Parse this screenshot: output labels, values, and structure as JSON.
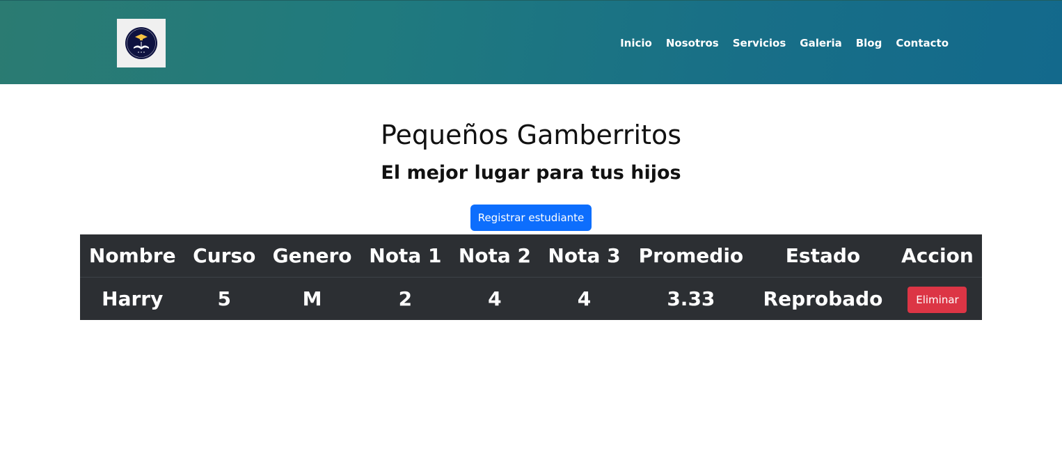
{
  "header": {
    "logo": "graduation-cap-book-logo",
    "nav": [
      "Inicio",
      "Nosotros",
      "Servicios",
      "Galeria",
      "Blog",
      "Contacto"
    ]
  },
  "main": {
    "title": "Pequeños Gamberritos",
    "subtitle": "El mejor lugar para tus hijos",
    "register_label": "Registrar estudiante"
  },
  "table": {
    "headers": [
      "Nombre",
      "Curso",
      "Genero",
      "Nota 1",
      "Nota 2",
      "Nota 3",
      "Promedio",
      "Estado",
      "Accion"
    ],
    "rows": [
      {
        "nombre": "Harry",
        "curso": "5",
        "genero": "M",
        "nota1": "2",
        "nota2": "4",
        "nota3": "4",
        "promedio": "3.33",
        "estado": "Reprobado",
        "accion": "Eliminar"
      }
    ]
  },
  "colors": {
    "primary": "#0d6efd",
    "danger": "#dc3545",
    "table_bg": "#2c2f33"
  }
}
